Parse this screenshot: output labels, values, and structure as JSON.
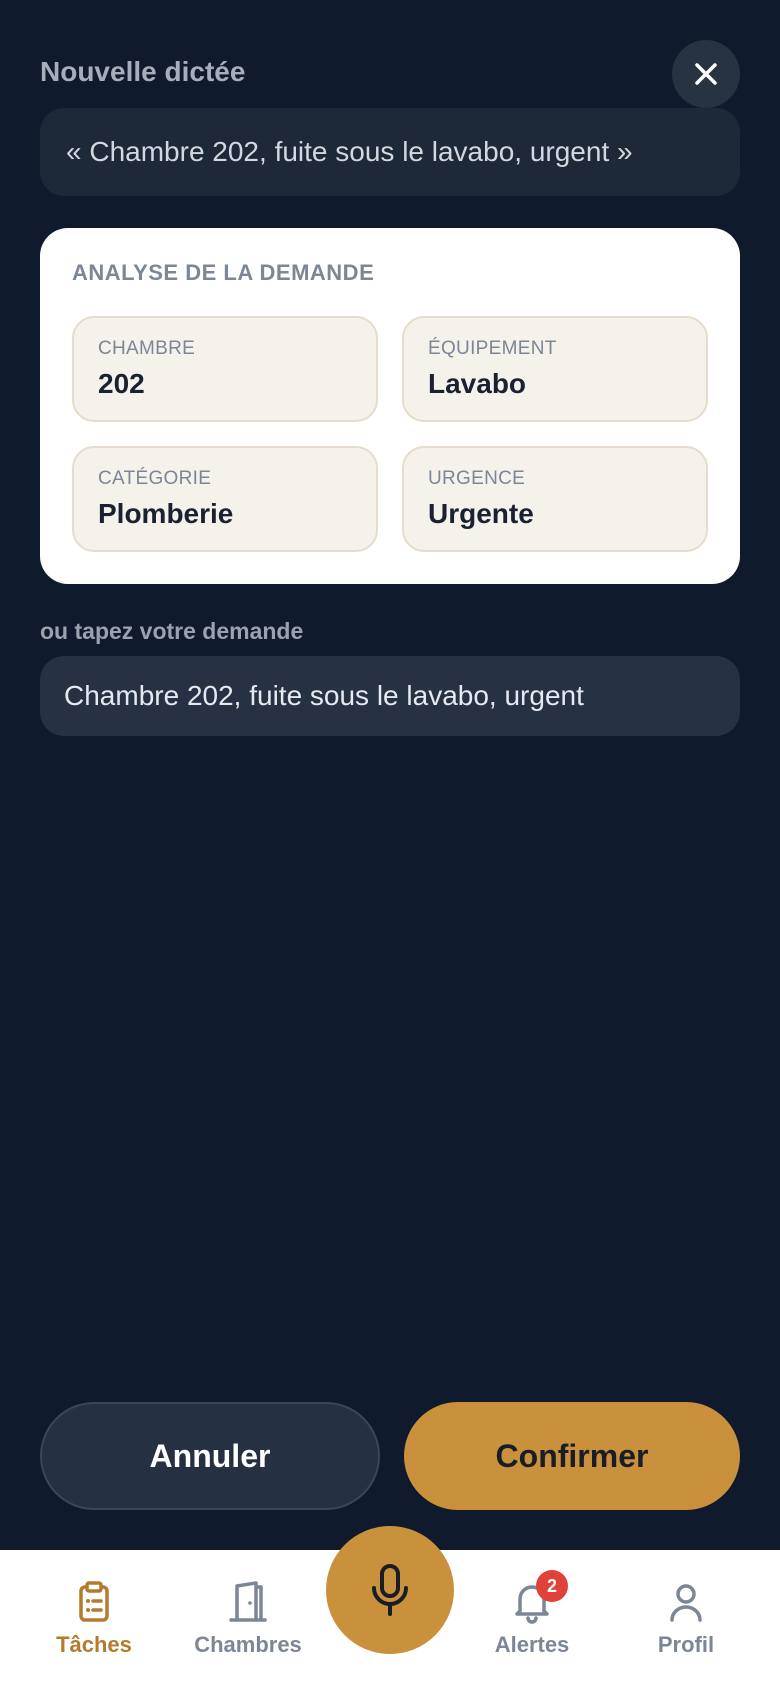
{
  "header": {
    "title": "Nouvelle dictée",
    "close_icon": "close-icon"
  },
  "transcript": {
    "text": "« Chambre 202, fuite sous le lavabo, urgent »"
  },
  "analysis": {
    "title": "ANALYSE DE LA DEMANDE",
    "fields": [
      {
        "label": "CHAMBRE",
        "value": "202"
      },
      {
        "label": "ÉQUIPEMENT",
        "value": "Lavabo"
      },
      {
        "label": "CATÉGORIE",
        "value": "Plomberie"
      },
      {
        "label": "URGENCE",
        "value": "Urgente"
      }
    ]
  },
  "manual_input": {
    "hint": "ou tapez votre demande",
    "value": "Chambre 202, fuite sous le lavabo, urgent"
  },
  "actions": {
    "cancel_label": "Annuler",
    "confirm_label": "Confirmer"
  },
  "bottom_nav": {
    "items": [
      {
        "label": "Tâches",
        "icon": "clipboard-icon",
        "active": true
      },
      {
        "label": "Chambres",
        "icon": "door-icon",
        "active": false
      },
      {
        "label": "Alertes",
        "icon": "bell-icon",
        "active": false,
        "badge": "2"
      },
      {
        "label": "Profil",
        "icon": "user-icon",
        "active": false
      }
    ],
    "fab_icon": "microphone-icon"
  },
  "colors": {
    "background": "#0f1a2c",
    "accent": "#c9913c",
    "badge": "#e0413a"
  }
}
